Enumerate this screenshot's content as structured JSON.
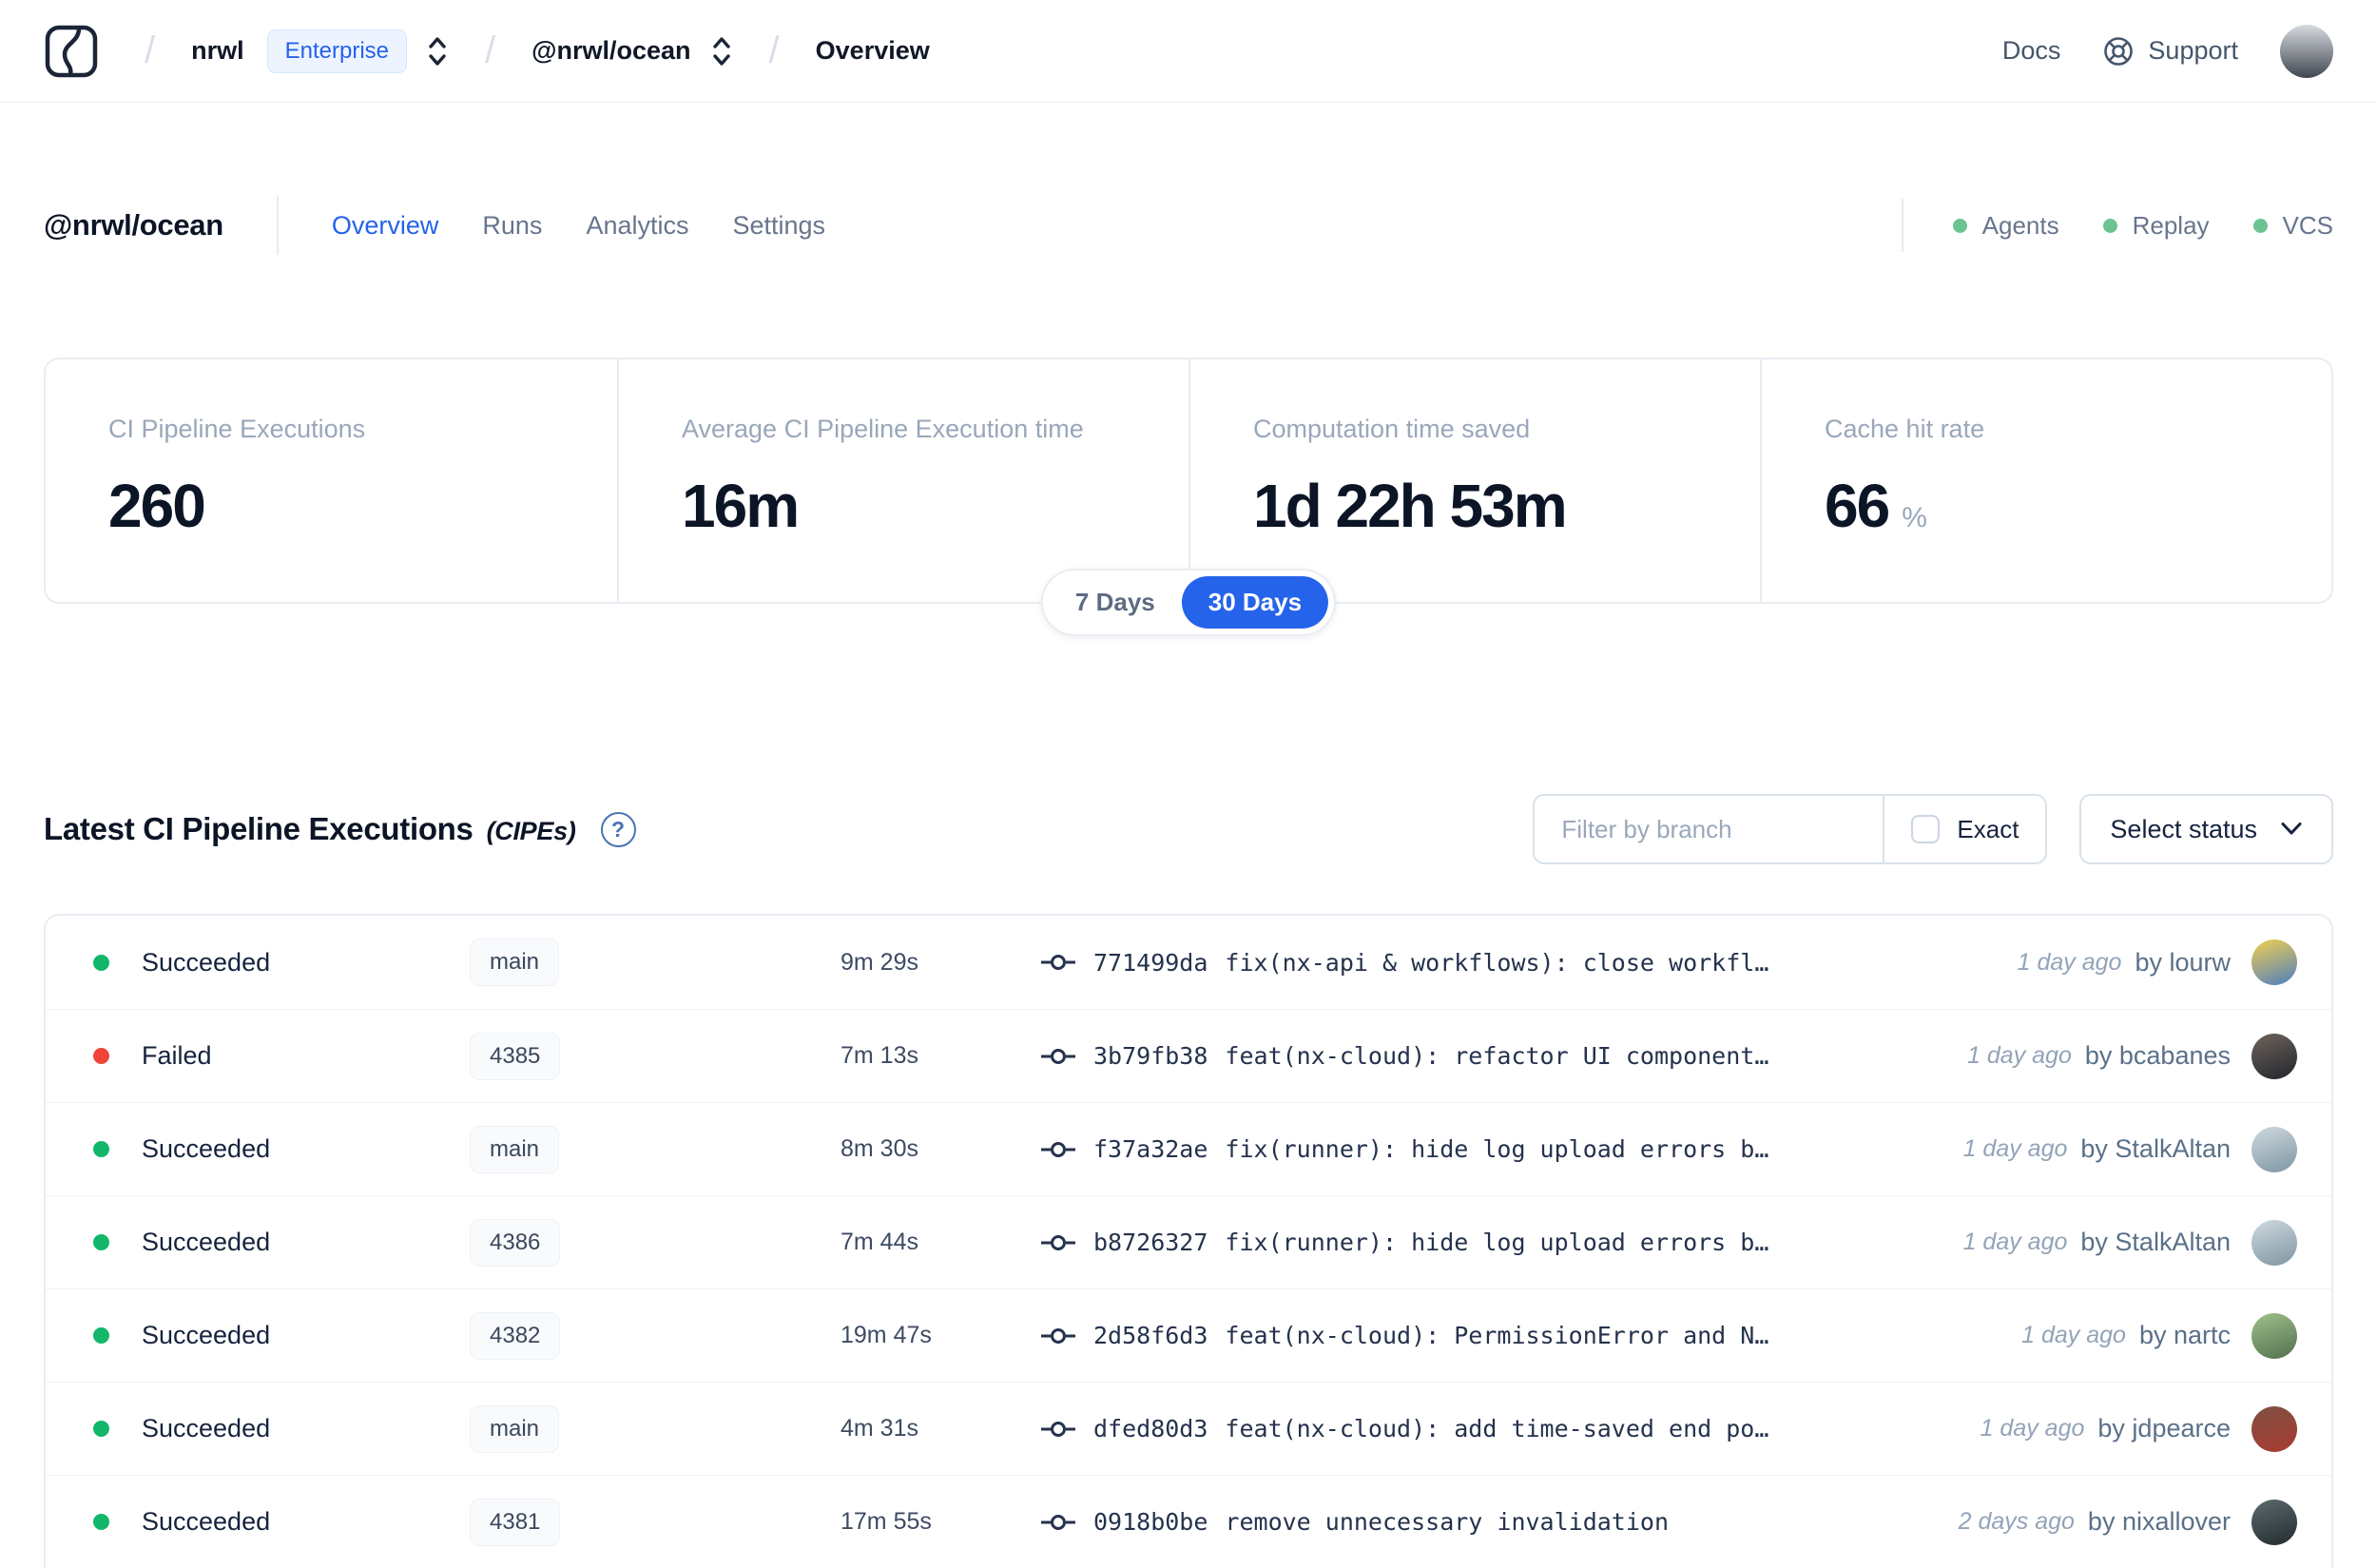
{
  "colors": {
    "accent": "#2563eb",
    "success": "#12b76a",
    "danger": "#f04438",
    "service_status_dot": "#6cc392"
  },
  "nav": {
    "org": "nrwl",
    "org_badge": "Enterprise",
    "workspace": "@nrwl/ocean",
    "page": "Overview",
    "docs_label": "Docs",
    "support_label": "Support",
    "avatar_colors": [
      "#d7dbe0",
      "#414750"
    ]
  },
  "header": {
    "title": "@nrwl/ocean",
    "tabs": [
      {
        "label": "Overview",
        "active": true
      },
      {
        "label": "Runs",
        "active": false
      },
      {
        "label": "Analytics",
        "active": false
      },
      {
        "label": "Settings",
        "active": false
      }
    ],
    "services": [
      {
        "label": "Agents",
        "status_color": "#6cc392"
      },
      {
        "label": "Replay",
        "status_color": "#6cc392"
      },
      {
        "label": "VCS",
        "status_color": "#6cc392"
      }
    ]
  },
  "stats": {
    "cards": [
      {
        "label": "CI Pipeline Executions",
        "value": "260",
        "suffix": ""
      },
      {
        "label": "Average CI Pipeline Execution time",
        "value": "16m",
        "suffix": ""
      },
      {
        "label": "Computation time saved",
        "value": "1d 22h 53m",
        "suffix": ""
      },
      {
        "label": "Cache hit rate",
        "value": "66",
        "suffix": "%"
      }
    ],
    "range_toggle": {
      "options": [
        "7 Days",
        "30 Days"
      ],
      "selected": "30 Days"
    }
  },
  "cipes": {
    "title": "Latest CI Pipeline Executions",
    "title_suffix": "(CIPEs)",
    "filter_placeholder": "Filter by branch",
    "exact_label": "Exact",
    "exact_checked": false,
    "select_status_label": "Select status",
    "rows": [
      {
        "status": "Succeeded",
        "status_color": "#12b76a",
        "branch": "main",
        "duration": "9m 29s",
        "commit_hash": "771499da",
        "commit_message": "fix(nx-api & workflows): close workfl…",
        "time_ago": "1 day ago",
        "author": "by lourw",
        "avatar_colors": [
          "#f2cf4e",
          "#4e7fc0"
        ]
      },
      {
        "status": "Failed",
        "status_color": "#f04438",
        "branch": "4385",
        "duration": "7m 13s",
        "commit_hash": "3b79fb38",
        "commit_message": "feat(nx-cloud): refactor UI component…",
        "time_ago": "1 day ago",
        "author": "by bcabanes",
        "avatar_colors": [
          "#6e635c",
          "#23262d"
        ]
      },
      {
        "status": "Succeeded",
        "status_color": "#12b76a",
        "branch": "main",
        "duration": "8m 30s",
        "commit_hash": "f37a32ae",
        "commit_message": "fix(runner): hide log upload errors b…",
        "time_ago": "1 day ago",
        "author": "by StalkAltan",
        "avatar_colors": [
          "#cfd9df",
          "#7e96a3"
        ]
      },
      {
        "status": "Succeeded",
        "status_color": "#12b76a",
        "branch": "4386",
        "duration": "7m 44s",
        "commit_hash": "b8726327",
        "commit_message": "fix(runner): hide log upload errors b…",
        "time_ago": "1 day ago",
        "author": "by StalkAltan",
        "avatar_colors": [
          "#cfd9df",
          "#7e96a3"
        ]
      },
      {
        "status": "Succeeded",
        "status_color": "#12b76a",
        "branch": "4382",
        "duration": "19m 47s",
        "commit_hash": "2d58f6d3",
        "commit_message": "feat(nx-cloud): PermissionError and N…",
        "time_ago": "1 day ago",
        "author": "by nartc",
        "avatar_colors": [
          "#9fc08b",
          "#52704e"
        ]
      },
      {
        "status": "Succeeded",
        "status_color": "#12b76a",
        "branch": "main",
        "duration": "4m 31s",
        "commit_hash": "dfed80d3",
        "commit_message": "feat(nx-cloud): add time-saved end po…",
        "time_ago": "1 day ago",
        "author": "by jdpearce",
        "avatar_colors": [
          "#7d5142",
          "#aa3b31"
        ]
      },
      {
        "status": "Succeeded",
        "status_color": "#12b76a",
        "branch": "4381",
        "duration": "17m 55s",
        "commit_hash": "0918b0be",
        "commit_message": "remove unnecessary invalidation",
        "time_ago": "2 days ago",
        "author": "by nixallover",
        "avatar_colors": [
          "#5c6a6e",
          "#232c2f"
        ]
      }
    ]
  }
}
